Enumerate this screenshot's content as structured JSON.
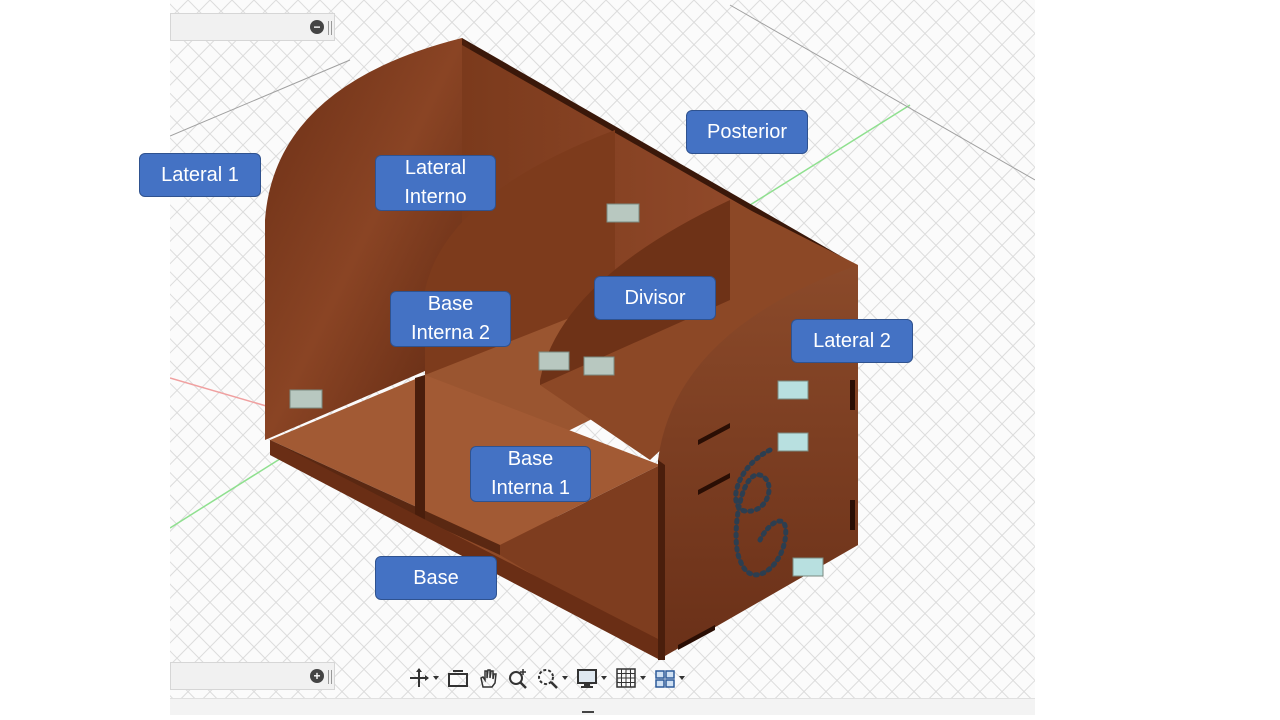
{
  "viewport": {
    "name": "3D model viewport"
  },
  "labels": {
    "lateral1": "Lateral 1",
    "lateral_interno": "Lateral\nInterno",
    "posterior": "Posterior",
    "base_interna_2": "Base\nInterna 2",
    "divisor": "Divisor",
    "lateral2": "Lateral 2",
    "base_interna_1": "Base\nInterna 1",
    "base": "Base"
  },
  "toolbar": {
    "tools": [
      "orbit-icon",
      "look-at-icon",
      "pan-icon",
      "zoom-icon",
      "fit-icon",
      "display-settings-icon",
      "grid-settings-icon",
      "viewports-icon"
    ]
  },
  "panels": {
    "top_button": "−",
    "bottom_button": "+"
  },
  "colors": {
    "label_fill": "#4472c4",
    "wood": "#7a3a1e",
    "grid": "#d8d8d8"
  }
}
